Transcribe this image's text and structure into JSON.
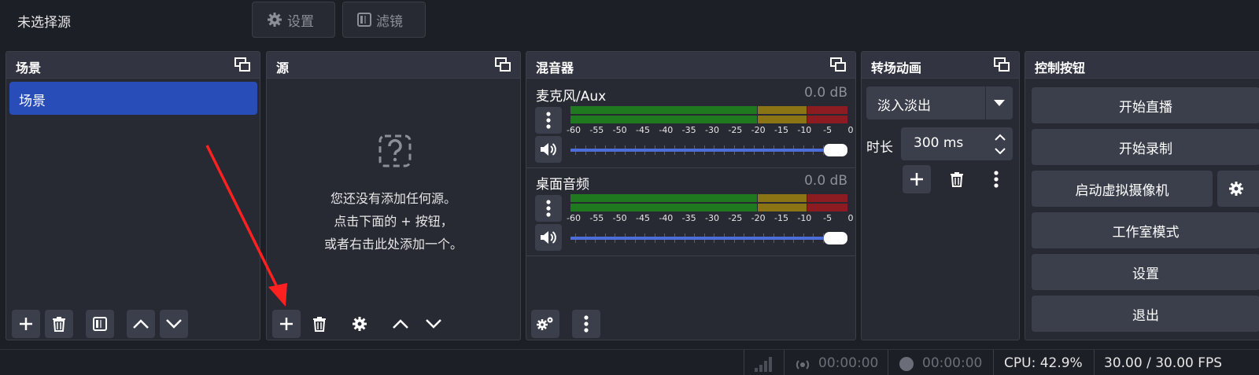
{
  "topbar": {
    "title": "未选择源",
    "settings_label": "设置",
    "filters_label": "滤镜"
  },
  "scene_dock": {
    "title": "场景",
    "items": [
      {
        "label": "场景",
        "selected": true
      }
    ]
  },
  "source_dock": {
    "title": "源",
    "empty_lines": [
      "您还没有添加任何源。",
      "点击下面的 + 按钮，",
      "或者右击此处添加一个。"
    ]
  },
  "mixer_dock": {
    "title": "混音器",
    "channels": [
      {
        "name": "麦克风/Aux",
        "db": "0.0 dB",
        "volume_fraction": 1.0
      },
      {
        "name": "桌面音频",
        "db": "0.0 dB",
        "volume_fraction": 1.0
      }
    ],
    "scale_labels": [
      "-60",
      "-55",
      "-50",
      "-45",
      "-40",
      "-35",
      "-30",
      "-25",
      "-20",
      "-15",
      "-10",
      "-5",
      "0"
    ]
  },
  "transition_dock": {
    "title": "转场动画",
    "selected": "淡入淡出",
    "duration_label": "时长",
    "duration_value": "300 ms"
  },
  "controls_dock": {
    "title": "控制按钮",
    "buttons": [
      "开始直播",
      "开始录制",
      "启动虚拟摄像机",
      "工作室模式",
      "设置",
      "退出"
    ]
  },
  "statusbar": {
    "stream_time": "00:00:00",
    "record_time": "00:00:00",
    "cpu": "CPU: 42.9%",
    "fps": "30.00 / 30.00 FPS"
  },
  "colors": {
    "accent": "#284cb8",
    "meter_green": "#1f7a1f",
    "meter_yellow": "#8a7414",
    "meter_red": "#8c1c22",
    "bg": "#1d1f26"
  },
  "icons": [
    "gear-icon",
    "filter-icon",
    "float-icon",
    "plus-icon",
    "trash-icon",
    "up-icon",
    "down-icon",
    "question-icon",
    "kebab-icon",
    "volume-icon",
    "network-icon",
    "stream-icon",
    "record-icon"
  ]
}
